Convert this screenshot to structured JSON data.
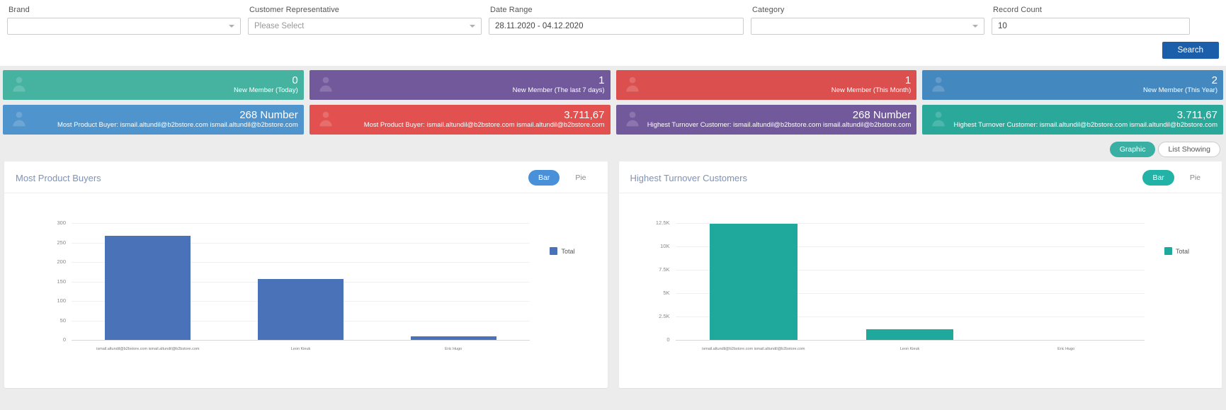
{
  "filters": {
    "brand": {
      "label": "Brand",
      "value": "",
      "placeholder": ""
    },
    "representative": {
      "label": "Customer Representative",
      "value": "",
      "placeholder": "Please Select"
    },
    "date_range": {
      "label": "Date Range",
      "value": "28.11.2020 - 04.12.2020"
    },
    "category": {
      "label": "Category",
      "value": "",
      "placeholder": ""
    },
    "record_count": {
      "label": "Record Count",
      "value": "10"
    },
    "search_button": "Search"
  },
  "stat_cards": [
    {
      "value": "0",
      "label": "New Member (Today)",
      "color": "#45b3a0"
    },
    {
      "value": "1",
      "label": "New Member (The last 7 days)",
      "color": "#72599b"
    },
    {
      "value": "1",
      "label": "New Member (This Month)",
      "color": "#db4f4f"
    },
    {
      "value": "2",
      "label": "New Member (This Year)",
      "color": "#4488c0"
    },
    {
      "value": "268 Number",
      "label": "Most Product Buyer: ismail.altundil@b2bstore.com ismail.altundil@b2bstore.com",
      "color": "#4f94cd"
    },
    {
      "value": "3.711,67",
      "label": "Most Product Buyer: ismail.altundil@b2bstore.com ismail.altundil@b2bstore.com",
      "color": "#e2504f"
    },
    {
      "value": "268 Number",
      "label": "Highest Turnover Customer: ismail.altundil@b2bstore.com ismail.altundil@b2bstore.com",
      "color": "#72599b"
    },
    {
      "value": "3.711,67",
      "label": "Highest Turnover Customer: ismail.altundil@b2bstore.com ismail.altundil@b2bstore.com",
      "color": "#2aa99b"
    }
  ],
  "view_toggle": {
    "graphic": "Graphic",
    "list": "List Showing",
    "active": "Graphic"
  },
  "panels": [
    {
      "title": "Most Product Buyers",
      "bar_label": "Bar",
      "pie_label": "Pie"
    },
    {
      "title": "Highest Turnover Customers",
      "bar_label": "Bar",
      "pie_label": "Pie"
    }
  ],
  "chart_data": [
    {
      "type": "bar",
      "title": "Most Product Buyers",
      "categories": [
        "ismail.altundil@b2bstore.com ismail.altundil@b2bstore.com",
        "Leon Kieuk",
        "Eric Hugo"
      ],
      "values": [
        268,
        157,
        10
      ],
      "series": [
        {
          "name": "Total",
          "values": [
            268,
            157,
            10
          ]
        }
      ],
      "legend": [
        "Total"
      ],
      "legend_position": "right",
      "color": "#4a72b8",
      "ylim": [
        0,
        300
      ],
      "yticks": [
        0,
        50,
        100,
        150,
        200,
        250,
        300
      ],
      "ytick_labels": [
        "0",
        "50",
        "100",
        "150",
        "200",
        "250",
        "300"
      ],
      "xlabel": "",
      "ylabel": "",
      "grid": true
    },
    {
      "type": "bar",
      "title": "Highest Turnover Customers",
      "categories": [
        "ismail.altundil@b2bstore.com ismail.altundil@b2bstore.com",
        "Leon Kieuk",
        "Eric Hugo"
      ],
      "values": [
        12400,
        1100,
        0
      ],
      "series": [
        {
          "name": "Total",
          "values": [
            12400,
            1100,
            0
          ]
        }
      ],
      "legend": [
        "Total"
      ],
      "legend_position": "right",
      "color": "#1fa89c",
      "ylim": [
        0,
        12500
      ],
      "yticks": [
        0,
        2500,
        5000,
        7500,
        10000,
        12500
      ],
      "ytick_labels": [
        "0",
        "2.5K",
        "5K",
        "7.5K",
        "10K",
        "12.5K"
      ],
      "xlabel": "",
      "ylabel": "",
      "grid": true
    }
  ]
}
